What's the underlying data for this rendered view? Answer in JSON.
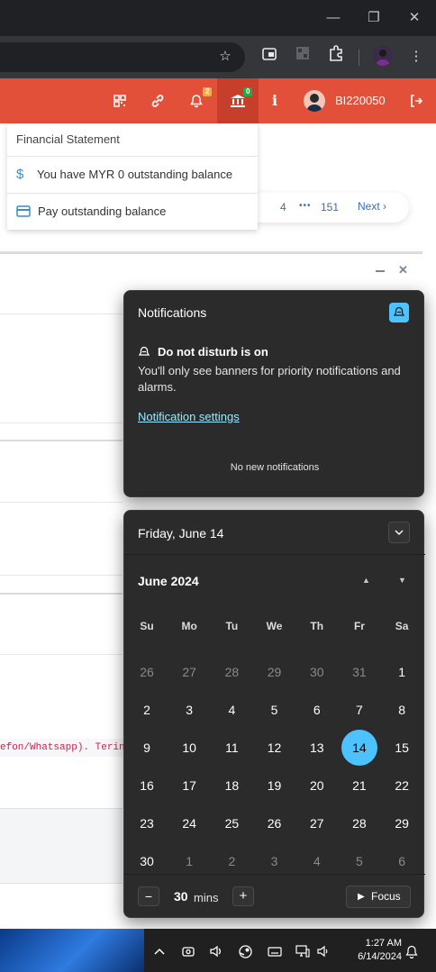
{
  "browser": {
    "window_controls": {
      "minimize": "—",
      "restore": "❐",
      "close": "✕"
    },
    "toolbar_icons": [
      "star-icon",
      "media-icon",
      "extension-disabled-icon",
      "extensions-icon",
      "profile-icon",
      "menu-icon"
    ]
  },
  "app_header": {
    "icons": [
      "qr-code-icon",
      "link-icon",
      "bell-icon",
      "bank-icon",
      "info-icon"
    ],
    "bell_badge": "2",
    "bank_badge": "0",
    "username": "BI220050",
    "logout_icon": "logout-icon"
  },
  "financial_dropdown": {
    "title": "Financial Statement",
    "items": [
      {
        "icon": "dollar-icon",
        "label": "You have MYR 0 outstanding balance"
      },
      {
        "icon": "card-icon",
        "label": "Pay outstanding balance"
      }
    ]
  },
  "pagination": {
    "page": "4",
    "ellipsis": "•••",
    "last": "151",
    "next": "Next"
  },
  "background_text": "efon/Whatsapp). Terin",
  "notifications": {
    "title": "Notifications",
    "dnd_title": "Do not disturb is on",
    "dnd_text": "You'll only see banners for priority notifications and alarms.",
    "settings_link": "Notification settings",
    "empty": "No new notifications"
  },
  "calendar": {
    "date_header": "Friday, June 14",
    "month": "June 2024",
    "weekdays": [
      "Su",
      "Mo",
      "Tu",
      "We",
      "Th",
      "Fr",
      "Sa"
    ],
    "weeks": [
      [
        "26",
        "27",
        "28",
        "29",
        "30",
        "31",
        "1"
      ],
      [
        "2",
        "3",
        "4",
        "5",
        "6",
        "7",
        "8"
      ],
      [
        "9",
        "10",
        "11",
        "12",
        "13",
        "14",
        "15"
      ],
      [
        "16",
        "17",
        "18",
        "19",
        "20",
        "21",
        "22"
      ],
      [
        "23",
        "24",
        "25",
        "26",
        "27",
        "28",
        "29"
      ],
      [
        "30",
        "1",
        "2",
        "3",
        "4",
        "5",
        "6"
      ]
    ],
    "selected": "14",
    "accent": "#4cc2ff"
  },
  "focus": {
    "minus": "−",
    "value": "30",
    "unit": "mins",
    "plus": "+",
    "button": "Focus"
  },
  "taskbar": {
    "time": "1:27 AM",
    "date": "6/14/2024"
  }
}
